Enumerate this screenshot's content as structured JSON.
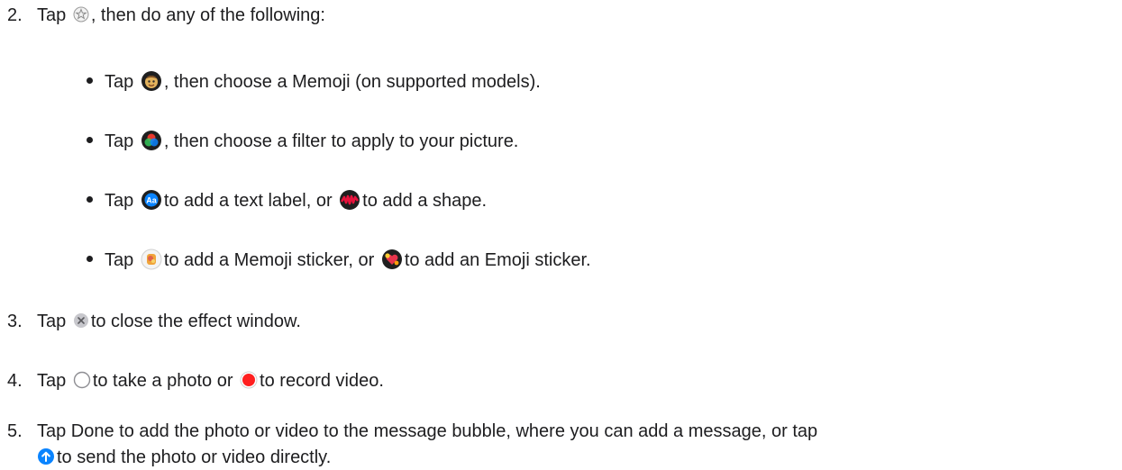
{
  "steps": [
    {
      "num": "2.",
      "before": "Tap",
      "after": ", then do any of the following:",
      "icon": "effects-star-icon"
    },
    {
      "num": "3.",
      "before": "Tap",
      "after": "to close the effect window.",
      "icon": "close-circle-icon"
    },
    {
      "num": "4.",
      "before": "Tap",
      "mid": "to take a photo or",
      "after": "to record video.",
      "icons": [
        "shutter-icon",
        "record-icon"
      ]
    },
    {
      "num": "5.",
      "line1": "Tap Done to add the photo or video to the message bubble, where you can add a message, or tap",
      "line2": "to send the photo or video directly.",
      "icon": "send-arrow-icon"
    }
  ],
  "bullets": [
    {
      "before": "Tap",
      "after": ", then choose a Memoji (on supported models).",
      "icon": "memoji-icon"
    },
    {
      "before": "Tap",
      "after": ", then choose a filter to apply to your picture.",
      "icon": "filters-icon"
    },
    {
      "before": "Tap",
      "mid": "to add a text label, or",
      "after": "to add a shape.",
      "icons": [
        "text-label-icon",
        "shapes-icon"
      ]
    },
    {
      "before": "Tap",
      "mid": "to add a Memoji sticker, or",
      "after": "to add an Emoji sticker.",
      "icons": [
        "memoji-sticker-icon",
        "emoji-sticker-icon"
      ]
    }
  ],
  "colors": {
    "text": "#1d1d1f",
    "record": "#ff1f1f",
    "send": "#0a84ff",
    "text_label": "#0a84ff",
    "shapes": "#e8123c"
  }
}
